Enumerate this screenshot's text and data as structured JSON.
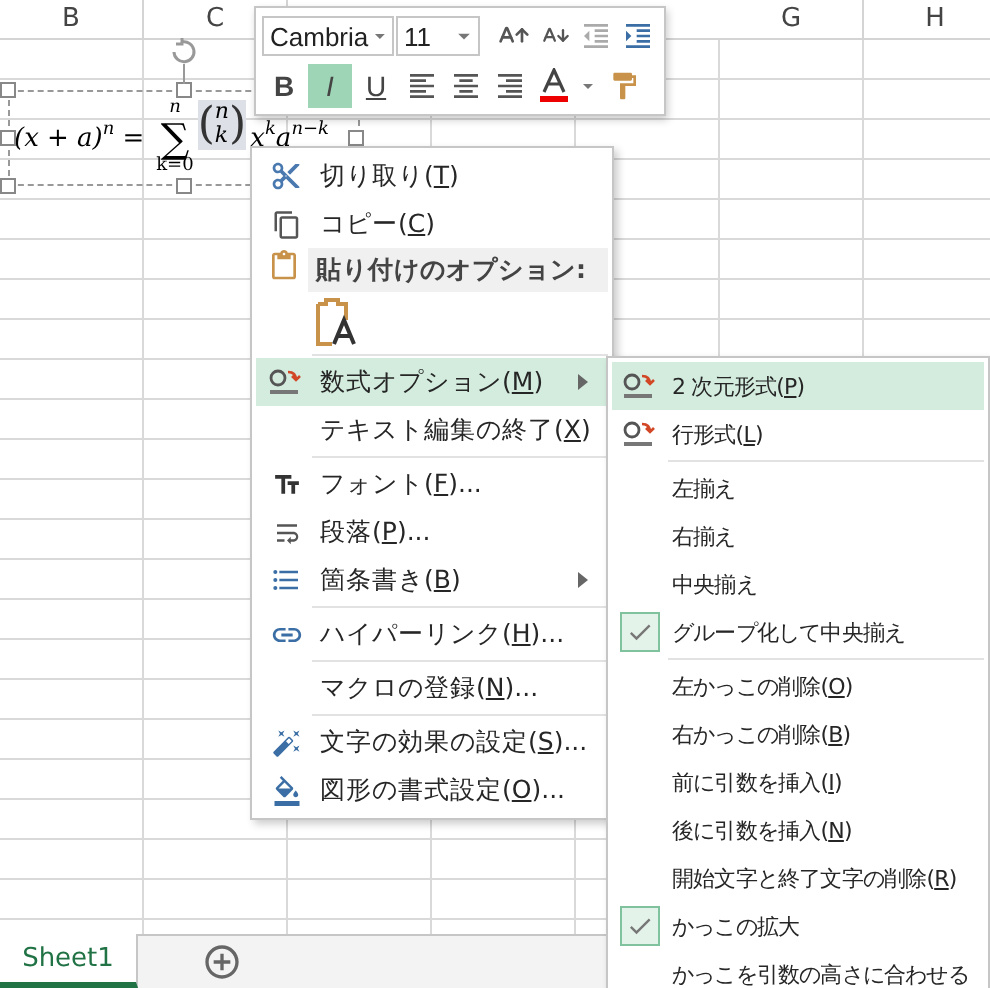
{
  "sheet": {
    "column_headers": [
      "B",
      "C",
      "G",
      "H"
    ],
    "tabs": [
      {
        "label": "Sheet1",
        "selected": true
      }
    ]
  },
  "equation": {
    "lhs": "(x + a)",
    "lhs_exp": "n",
    "equals": "=",
    "operator": "∑",
    "upper": "n",
    "lower": "k=0",
    "binom_open": "(",
    "binom_top": "n",
    "binom_bottom": "k",
    "binom_close": ")",
    "term1": "x",
    "term1_exp": "k",
    "term2": "a",
    "term2_exp": "n−k"
  },
  "mini_toolbar": {
    "font": "Cambria",
    "size": "11",
    "style_buttons": [
      {
        "label": "B",
        "selected": false
      },
      {
        "label": "I",
        "selected": true
      },
      {
        "label": "U",
        "selected": false
      }
    ]
  },
  "context_menu": {
    "items": [
      {
        "kind": "item",
        "label": [
          "切り取り(",
          "T",
          ")"
        ],
        "selected": false,
        "submenu": false
      },
      {
        "kind": "item",
        "label": [
          "コピー(",
          "C",
          ")"
        ],
        "selected": false,
        "submenu": false
      },
      {
        "kind": "header",
        "label": [
          "貼り付けのオプション:"
        ]
      },
      {
        "kind": "paste_options"
      },
      {
        "kind": "separator"
      },
      {
        "kind": "item",
        "label": [
          "数式オプション(",
          "M",
          ")"
        ],
        "selected": true,
        "submenu": true
      },
      {
        "kind": "item",
        "label": [
          "テキスト編集の終了(",
          "X",
          ")"
        ],
        "selected": false,
        "submenu": false
      },
      {
        "kind": "separator"
      },
      {
        "kind": "item",
        "label": [
          "フォント(",
          "F",
          ")..."
        ],
        "selected": false,
        "submenu": false
      },
      {
        "kind": "item",
        "label": [
          "段落(",
          "P",
          ")..."
        ],
        "selected": false,
        "submenu": false
      },
      {
        "kind": "item",
        "label": [
          "箇条書き(",
          "B",
          ")"
        ],
        "selected": false,
        "submenu": true
      },
      {
        "kind": "separator"
      },
      {
        "kind": "item",
        "label": [
          "ハイパーリンク(",
          "H",
          ")..."
        ],
        "selected": false,
        "submenu": false
      },
      {
        "kind": "separator"
      },
      {
        "kind": "item",
        "label": [
          "マクロの登録(",
          "N",
          ")..."
        ],
        "selected": false,
        "submenu": false
      },
      {
        "kind": "separator"
      },
      {
        "kind": "item",
        "label": [
          "文字の効果の設定(",
          "S",
          ")..."
        ],
        "selected": false,
        "submenu": false
      },
      {
        "kind": "item",
        "label": [
          "図形の書式設定(",
          "O",
          ")..."
        ],
        "selected": false,
        "submenu": false
      }
    ]
  },
  "submenu": {
    "items": [
      {
        "kind": "item",
        "label": [
          "2 次元形式(",
          "P",
          ")"
        ],
        "selected": true,
        "checked": false
      },
      {
        "kind": "item",
        "label": [
          "行形式(",
          "L",
          ")"
        ],
        "selected": false,
        "checked": false
      },
      {
        "kind": "separator"
      },
      {
        "kind": "item",
        "label": [
          "左揃え"
        ],
        "selected": false,
        "checked": false
      },
      {
        "kind": "item",
        "label": [
          "右揃え"
        ],
        "selected": false,
        "checked": false
      },
      {
        "kind": "item",
        "label": [
          "中央揃え"
        ],
        "selected": false,
        "checked": false
      },
      {
        "kind": "item",
        "label": [
          "グループ化して中央揃え"
        ],
        "selected": false,
        "checked": true
      },
      {
        "kind": "separator"
      },
      {
        "kind": "item",
        "label": [
          "左かっこの削除(",
          "O",
          ")"
        ],
        "selected": false,
        "checked": false
      },
      {
        "kind": "item",
        "label": [
          "右かっこの削除(",
          "B",
          ")"
        ],
        "selected": false,
        "checked": false
      },
      {
        "kind": "item",
        "label": [
          "前に引数を挿入(",
          "I",
          ")"
        ],
        "selected": false,
        "checked": false
      },
      {
        "kind": "item",
        "label": [
          "後に引数を挿入(",
          "N",
          ")"
        ],
        "selected": false,
        "checked": false
      },
      {
        "kind": "item",
        "label": [
          "開始文字と終了文字の削除(",
          "R",
          ")"
        ],
        "selected": false,
        "checked": false
      },
      {
        "kind": "item",
        "label": [
          "かっこの拡大"
        ],
        "selected": false,
        "checked": true
      },
      {
        "kind": "item",
        "label": [
          "かっこを引数の高さに合わせる"
        ],
        "selected": false,
        "checked": false
      }
    ]
  }
}
